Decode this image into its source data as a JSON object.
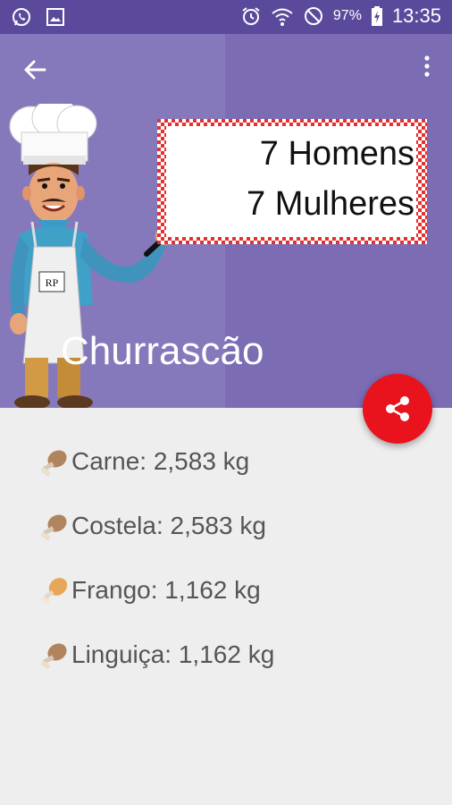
{
  "status_bar": {
    "battery": "97%",
    "time": "13:35",
    "icons": [
      "whatsapp-icon",
      "gallery-icon",
      "alarm-icon",
      "wifi-icon",
      "do-not-disturb-icon",
      "battery-charging-icon"
    ]
  },
  "toolbar": {
    "back_icon": "arrow-back-icon",
    "more_icon": "more-vertical-icon"
  },
  "header": {
    "sign_line1": "7 Homens",
    "sign_line2": "7 Mulheres",
    "chef_apron_text": "RP",
    "title": "Churrascão",
    "share_icon": "share-icon"
  },
  "results": [
    {
      "label": "Carne: 2,583 kg",
      "icon": "meat-drumstick-icon"
    },
    {
      "label": "Costela: 2,583 kg",
      "icon": "meat-drumstick-icon"
    },
    {
      "label": "Frango: 1,162 kg",
      "icon": "chicken-leg-icon"
    },
    {
      "label": "Linguiça: 1,162 kg",
      "icon": "meat-drumstick-icon"
    }
  ],
  "colors": {
    "status_bar": "#5b4a9c",
    "header": "#7b6cb4",
    "fab": "#e8131c",
    "background": "#eeeeee"
  }
}
